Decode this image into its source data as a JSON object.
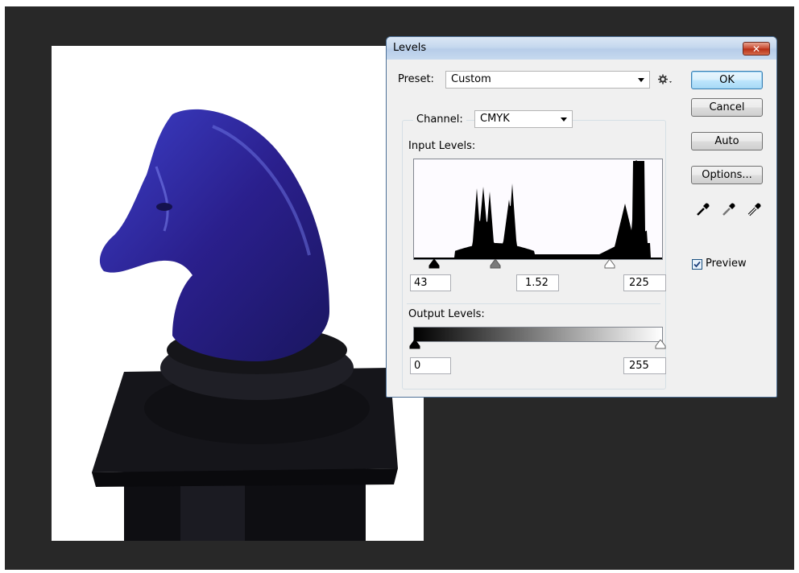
{
  "dialog": {
    "title": "Levels",
    "close_glyph": "✕",
    "preset_label": "Preset:",
    "preset_value": "Custom",
    "channel_label": "Channel:",
    "channel_value": "CMYK",
    "input_levels_label": "Input Levels:",
    "input_black": "43",
    "input_gamma": "1.52",
    "input_white": "225",
    "output_levels_label": "Output Levels:",
    "output_black": "0",
    "output_white": "255",
    "buttons": {
      "ok": "OK",
      "cancel": "Cancel",
      "auto": "Auto",
      "options": "Options..."
    },
    "preview_label": "Preview",
    "preview_checked": true,
    "icons": [
      "preset-options-gear-icon",
      "black-eyedropper-icon",
      "gray-eyedropper-icon",
      "white-eyedropper-icon",
      "dropdown-arrow-icon"
    ]
  },
  "colors": {
    "accent": "#3399ff",
    "title_bar": "#c5d8ee",
    "workspace": "#282828",
    "sculpture": "#2a1f8c"
  }
}
